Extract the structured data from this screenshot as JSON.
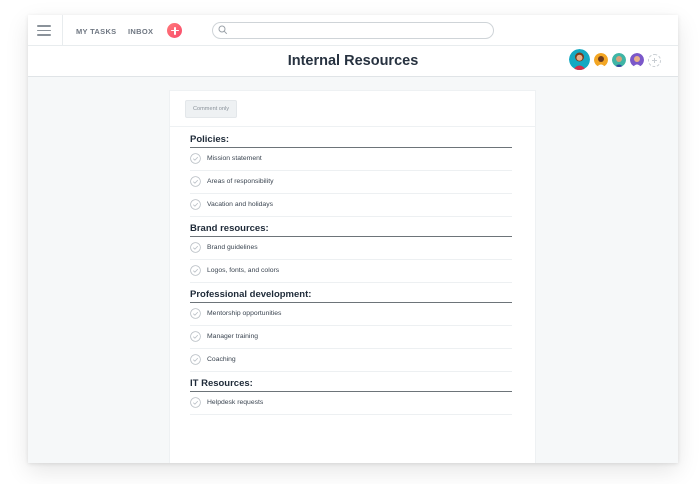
{
  "topbar": {
    "nav": [
      "MY TASKS",
      "INBOX"
    ],
    "search": {
      "placeholder": ""
    },
    "icons": [
      "hamburger-icon",
      "plus-icon",
      "search-icon"
    ],
    "accent": "#f95b6c"
  },
  "header": {
    "title": "Internal Resources",
    "members": 4
  },
  "document": {
    "badge": "Comment only",
    "sections": [
      {
        "title": "Policies:",
        "tasks": [
          "Mission statement",
          "Areas of responsibility",
          "Vacation and holidays"
        ]
      },
      {
        "title": "Brand resources:",
        "tasks": [
          "Brand guidelines",
          "Logos, fonts, and colors"
        ]
      },
      {
        "title": "Professional development:",
        "tasks": [
          "Mentorship opportunities",
          "Manager training",
          "Coaching"
        ]
      },
      {
        "title": "IT Resources:",
        "tasks": [
          "Helpdesk requests"
        ]
      }
    ]
  }
}
